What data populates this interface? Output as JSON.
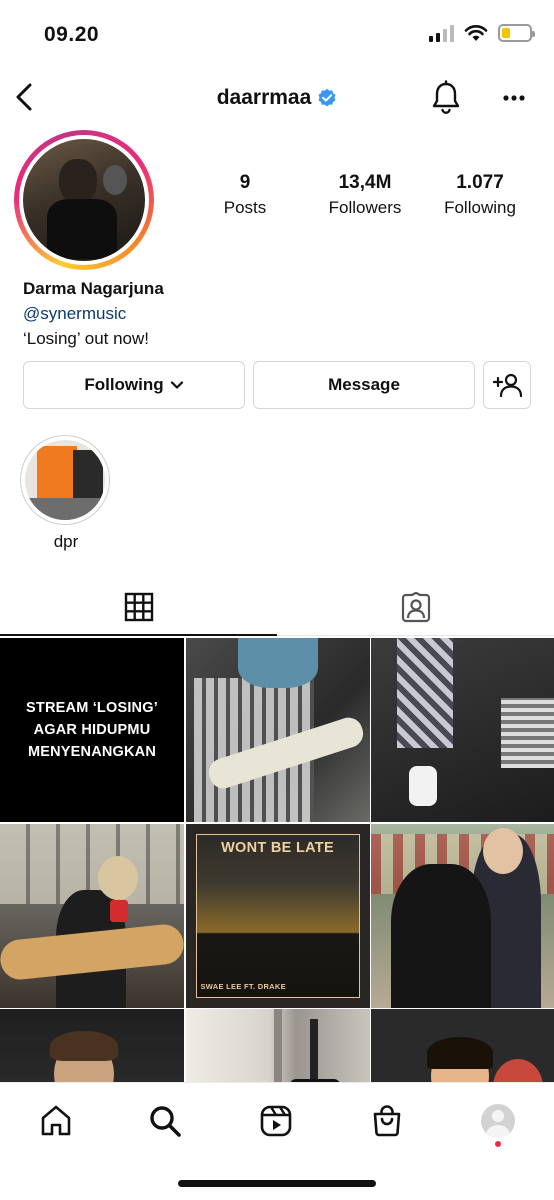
{
  "status_bar": {
    "time": "09.20",
    "battery_level": 0.3
  },
  "header": {
    "username": "daarrmaa",
    "verified": true
  },
  "profile": {
    "stats": [
      {
        "value": "9",
        "label": "Posts"
      },
      {
        "value": "13,4M",
        "label": "Followers"
      },
      {
        "value": "1.077",
        "label": "Following"
      }
    ],
    "name": "Darma Nagarjuna",
    "link": "@synermusic",
    "bio": "‘Losing’ out now!"
  },
  "actions": {
    "following_label": "Following",
    "message_label": "Message"
  },
  "highlights": [
    {
      "label": "dpr"
    }
  ],
  "tabs": {
    "active": "grid"
  },
  "posts": {
    "tile1_text": "STREAM ‘LOSING’\nAGAR HIDUPMU\nMENYENANGKAN",
    "tile5_title": "WONT BE LATE",
    "tile5_credit": "SWAE LEE FT. DRAKE"
  },
  "colors": {
    "verified": "#3897f0",
    "link": "#0c3a6b",
    "notification": "#ee2a4b",
    "battery": "#f5c400"
  },
  "icons": {
    "back": "chevron-left-icon",
    "bell": "bell-icon",
    "more": "more-horizontal-icon",
    "grid": "grid-icon",
    "tagged": "tagged-user-icon",
    "home": "home-icon",
    "search": "search-icon",
    "reels": "reels-icon",
    "shop": "shop-icon"
  }
}
